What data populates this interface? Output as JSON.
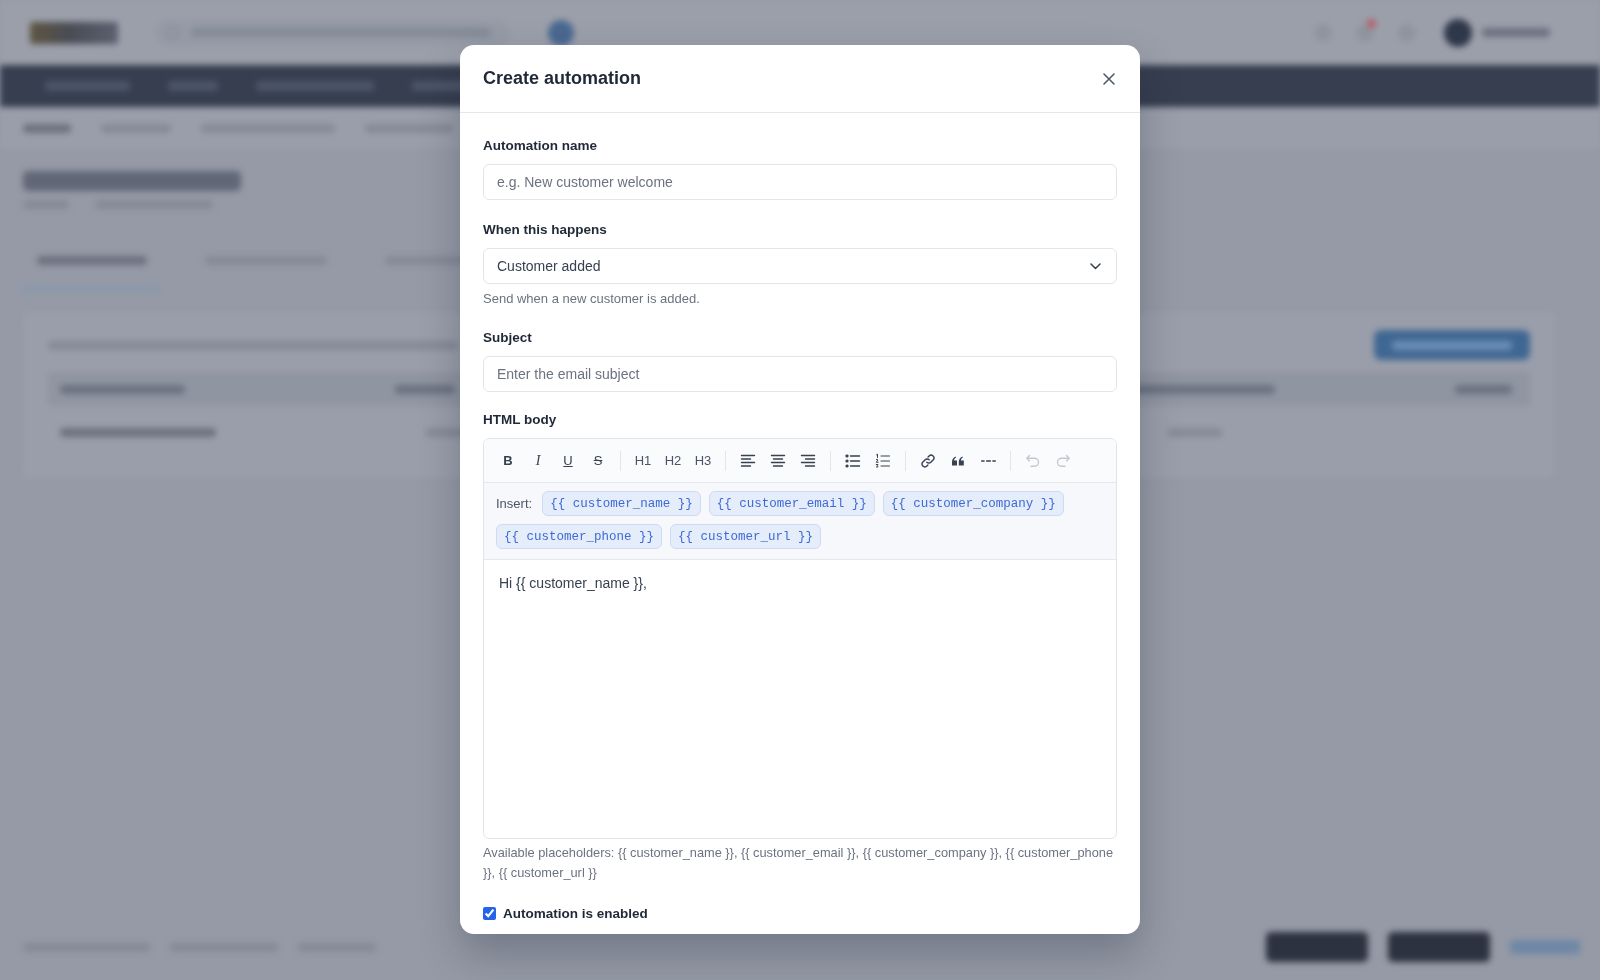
{
  "dialog": {
    "title": "Create automation"
  },
  "form": {
    "name": {
      "label": "Automation name",
      "placeholder": "e.g. New customer welcome"
    },
    "trigger": {
      "label": "When this happens",
      "value": "Customer added",
      "help": "Send when a new customer is added."
    },
    "subject": {
      "label": "Subject",
      "placeholder": "Enter the email subject"
    },
    "body": {
      "label": "HTML body",
      "toolbar": [
        {
          "items": [
            {
              "kind": "bold",
              "label": "B",
              "disabled": false
            },
            {
              "kind": "italic",
              "label": "I",
              "disabled": false
            },
            {
              "kind": "underline",
              "label": "U",
              "disabled": false
            },
            {
              "kind": "strike",
              "label": "S",
              "disabled": false
            }
          ]
        },
        {
          "items": [
            {
              "kind": "heading",
              "label": "H1",
              "disabled": false
            },
            {
              "kind": "heading",
              "label": "H2",
              "disabled": false
            },
            {
              "kind": "heading",
              "label": "H3",
              "disabled": false
            }
          ]
        },
        {
          "items": [
            {
              "kind": "left",
              "disabled": false
            },
            {
              "kind": "center",
              "disabled": false
            },
            {
              "kind": "right",
              "disabled": false
            }
          ]
        },
        {
          "items": [
            {
              "kind": "bullets",
              "disabled": false
            },
            {
              "kind": "numbers",
              "disabled": false
            }
          ]
        },
        {
          "items": [
            {
              "kind": "link",
              "disabled": false
            },
            {
              "kind": "quote",
              "disabled": false
            },
            {
              "kind": "rule",
              "disabled": false
            }
          ]
        },
        {
          "items": [
            {
              "kind": "undo",
              "disabled": true
            },
            {
              "kind": "redo",
              "disabled": true
            }
          ]
        }
      ],
      "insert_label": "Insert:",
      "insert_tags": [
        "{{ customer_name }}",
        "{{ customer_email }}",
        "{{ customer_company }}",
        "{{ customer_phone }}",
        "{{ customer_url }}"
      ],
      "content": "Hi {{ customer_name }},",
      "hint": "Available placeholders: {{ customer_name }}, {{ customer_email }}, {{ customer_company }}, {{ customer_phone }}, {{ customer_url }}"
    },
    "enabled": {
      "label": "Automation is enabled",
      "checked": true
    }
  }
}
